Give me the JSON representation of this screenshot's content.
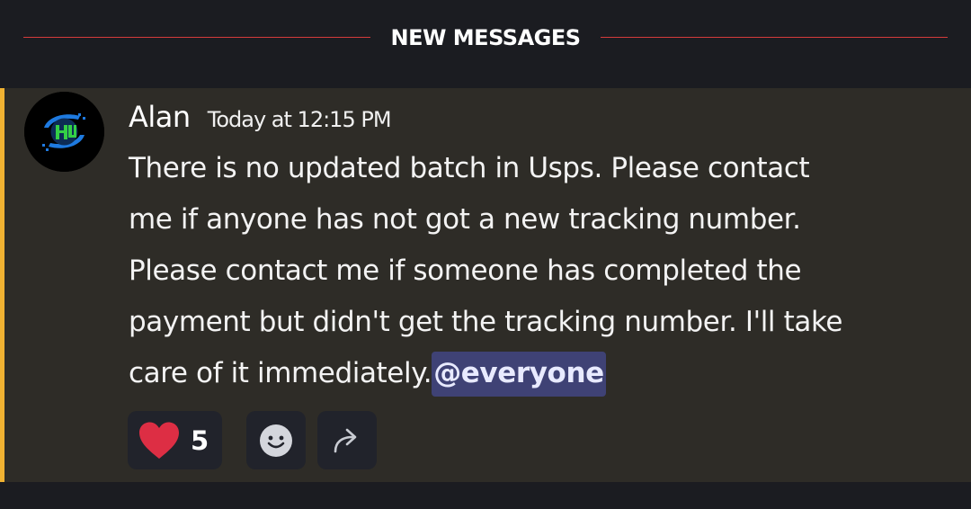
{
  "divider": {
    "label": "NEW MESSAGES",
    "line_color": "#d53b3b"
  },
  "message": {
    "author": "Alan",
    "timestamp": "Today at 12:15 PM",
    "lines": [
      "There is no updated batch in Usps. Please contact",
      "me if anyone has not got a new tracking number.",
      "Please contact me if someone has completed the",
      "payment but didn't get the tracking number. I'll take",
      "care of it immediately."
    ],
    "mention": "@everyone",
    "highlight_color": "#f0b232",
    "avatar_icon": "logo-avatar-icon"
  },
  "reactions": {
    "heart": {
      "emoji": "heart-emoji-icon",
      "count": "5"
    },
    "add_reaction_icon": "smiley-icon",
    "forward_icon": "forward-arrow-icon"
  }
}
